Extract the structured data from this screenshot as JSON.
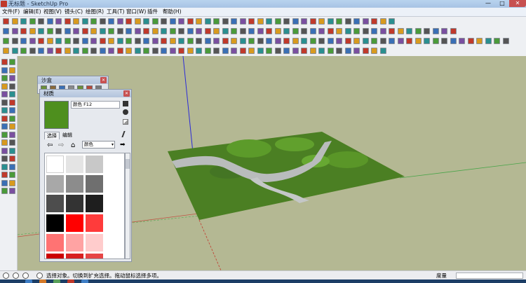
{
  "window": {
    "title": "无标题 - SketchUp Pro",
    "min_label": "—",
    "max_label": "□",
    "close_label": "✕"
  },
  "menu": [
    {
      "label": "文件(F)"
    },
    {
      "label": "编辑(E)"
    },
    {
      "label": "视图(V)"
    },
    {
      "label": "镜头(C)"
    },
    {
      "label": "绘图(R)"
    },
    {
      "label": "工具(T)"
    },
    {
      "label": "窗口(W)"
    },
    {
      "label": "插件"
    },
    {
      "label": "帮助(H)"
    }
  ],
  "sandbox_panel": {
    "title": "沙盒",
    "close_label": "✕"
  },
  "materials_panel": {
    "title": "材质",
    "close_label": "✕",
    "material_name": "颜色 F12",
    "current_color": "#4e8f1e",
    "tabs": [
      {
        "label": "选择"
      },
      {
        "label": "编辑"
      }
    ],
    "library": "颜色",
    "swatches": [
      "#ffffff",
      "#e4e4e4",
      "#c8c8c8",
      "#a8a8a8",
      "#8c8c8c",
      "#6f6f6f",
      "#4d4d4d",
      "#333333",
      "#1e1e1e",
      "#000000",
      "#ff0000",
      "#ff3b3b",
      "#ff7373",
      "#ffa3a3",
      "#ffcccc",
      "#cc0000",
      "#d82020",
      "#e64545"
    ]
  },
  "status_bar": {
    "message": "选择对象。切换到扩充选择。拖动鼠标选择多项。",
    "measurement_label": "度量"
  },
  "colors": {
    "sky_ground": "#b4b893",
    "terrain": "#4b7f23",
    "road": "#b9bcbc",
    "axis_red": "#c23b2f",
    "axis_green": "#4aa54a",
    "axis_blue": "#2b2bd8"
  }
}
